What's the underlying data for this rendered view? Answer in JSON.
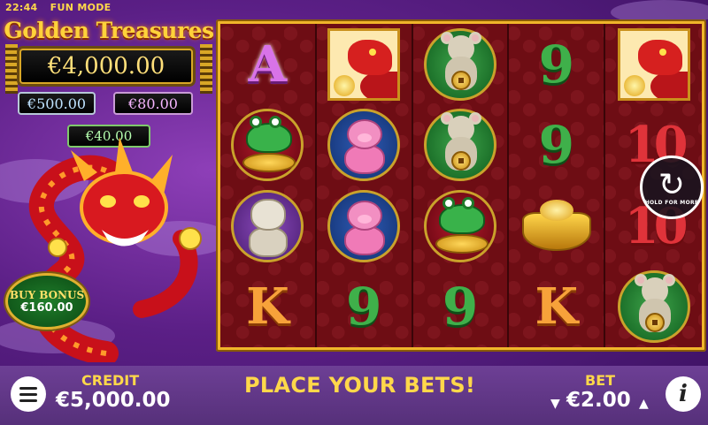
{
  "status": {
    "time": "22:44",
    "mode": "FUN MODE"
  },
  "game": {
    "title": "Golden Treasures"
  },
  "jackpots": {
    "grand": "€4,000.00",
    "major": "€500.00",
    "minor": "€80.00",
    "mini": "€40.00"
  },
  "buy_bonus": {
    "label": "BUY BONUS",
    "price": "€160.00"
  },
  "reels": [
    [
      "A",
      "frog",
      "fu-dog",
      "K"
    ],
    [
      "dragon",
      "pig",
      "pig",
      "9"
    ],
    [
      "rat",
      "rat",
      "frog",
      "9"
    ],
    [
      "9",
      "9",
      "gold-ingot",
      "K"
    ],
    [
      "dragon",
      "10",
      "10",
      "rat"
    ]
  ],
  "symbol_text": {
    "A": "A",
    "K": "K",
    "9": "9",
    "10": "10"
  },
  "autoplay": {
    "label": "HOLD FOR MORE"
  },
  "bottom": {
    "credit_label": "CREDIT",
    "credit_value": "€5,000.00",
    "message": "PLACE YOUR BETS!",
    "bet_label": "BET",
    "bet_value": "€2.00"
  },
  "icons": {
    "menu": "hamburger-icon",
    "info": "info-icon",
    "spin": "refresh-icon",
    "bet_down": "triangle-down-icon",
    "bet_up": "triangle-up-icon"
  },
  "colors": {
    "accent": "#ffd84a",
    "frame": "#f0b52a",
    "reel_bg": "#6e0d14"
  }
}
